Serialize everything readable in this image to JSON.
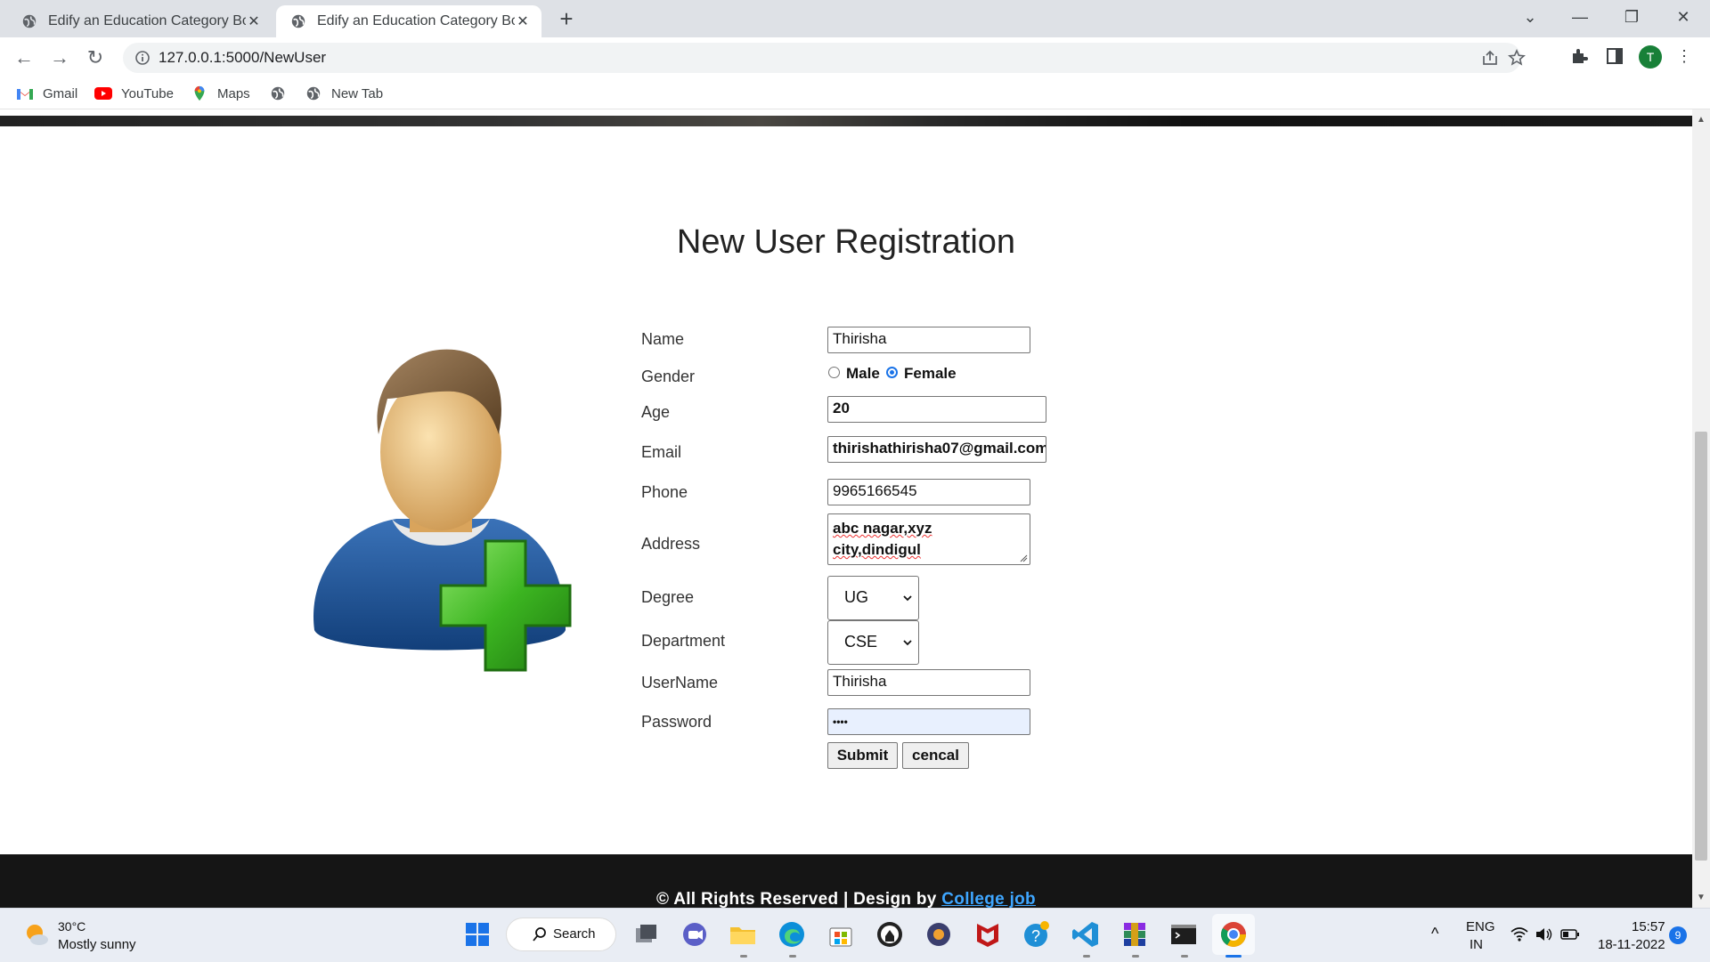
{
  "browser": {
    "tabs": [
      {
        "title": "Edify an Education Category Boo",
        "active": false
      },
      {
        "title": "Edify an Education Category Boo",
        "active": true
      }
    ],
    "url": "127.0.0.1:5000/NewUser",
    "profile_initial": "T",
    "bookmarks": [
      {
        "label": "Gmail",
        "icon": "gmail-icon"
      },
      {
        "label": "YouTube",
        "icon": "youtube-icon"
      },
      {
        "label": "Maps",
        "icon": "maps-icon"
      },
      {
        "label": "",
        "icon": "globe-icon"
      },
      {
        "label": "New Tab",
        "icon": "globe-icon"
      }
    ]
  },
  "page": {
    "title": "New User Registration",
    "form": {
      "name": {
        "label": "Name",
        "value": "Thirisha"
      },
      "gender": {
        "label": "Gender",
        "options": [
          "Male",
          "Female"
        ],
        "selected": "Female"
      },
      "age": {
        "label": "Age",
        "value": "20"
      },
      "email": {
        "label": "Email",
        "value": "thirishathirisha07@gmail.com"
      },
      "phone": {
        "label": "Phone",
        "value": "9965166545"
      },
      "address": {
        "label": "Address",
        "line1": "abc nagar,xyz",
        "line2": "city,dindigul"
      },
      "degree": {
        "label": "Degree",
        "value": "UG"
      },
      "department": {
        "label": "Department",
        "value": "CSE"
      },
      "username": {
        "label": "UserName",
        "value": "Thirisha"
      },
      "password": {
        "label": "Password",
        "value": "••••"
      },
      "submit_label": "Submit",
      "cancel_label": "cencal"
    },
    "footer": {
      "text": "© All Rights Reserved | Design by",
      "link": "College job"
    }
  },
  "taskbar": {
    "weather_temp": "30°C",
    "weather_desc": "Mostly sunny",
    "search_label": "Search",
    "lang1": "ENG",
    "lang2": "IN",
    "time": "15:57",
    "date": "18-11-2022",
    "notifications": "9"
  },
  "colors": {
    "accent": "#1a73e8",
    "footer_bg": "#151515",
    "link": "#3ea6ff",
    "plus_green": "#3cb521"
  }
}
